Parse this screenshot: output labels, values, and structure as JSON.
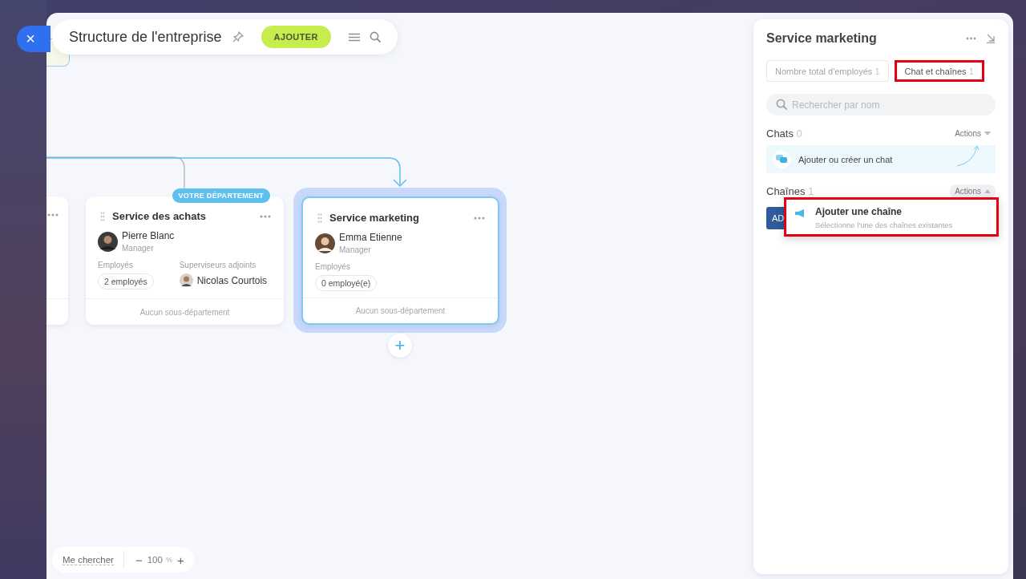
{
  "header": {
    "close": "×",
    "title": "Structure de l'entreprise",
    "add_button": "AJOUTER"
  },
  "departments": [
    {
      "name": "Service des achats",
      "badge": "VOTRE DÉPARTEMENT",
      "selected": false,
      "head": {
        "name": "Pierre Blanc",
        "role": "Manager"
      },
      "employees_label": "Employés",
      "employees": "2 employés",
      "deputies_label": "Superviseurs adjoints",
      "deputy": "Nicolas Courtois",
      "footer": "Aucun sous-département"
    },
    {
      "name": "Service marketing",
      "selected": true,
      "head": {
        "name": "Emma Etienne",
        "role": "Manager"
      },
      "employees_label": "Employés",
      "employees": "0 employé(e)",
      "footer": "Aucun sous-département"
    }
  ],
  "add_node": "+",
  "zoom": {
    "find_me": "Me chercher",
    "minus": "−",
    "value": "100",
    "unit": "%",
    "plus": "+"
  },
  "panel": {
    "title": "Service marketing",
    "tabs": [
      {
        "label": "Nombre total d'employés",
        "count": "1",
        "selected": false,
        "highlighted": false
      },
      {
        "label": "Chat et chaînes",
        "count": "1",
        "selected": true,
        "highlighted": true
      }
    ],
    "search_placeholder": "Rechercher par nom",
    "sections": [
      {
        "title": "Chats",
        "count": "0",
        "actions": "Actions",
        "expanded": false,
        "add_item": "Ajouter ou créer un chat"
      },
      {
        "title": "Chaînes",
        "count": "1",
        "actions": "Actions",
        "expanded": true,
        "button": "AD"
      }
    ],
    "menu": [
      {
        "title": "Ajouter une chaîne",
        "subtitle": "Sélectionne l'une des chaînes existantes",
        "highlighted": true
      }
    ]
  }
}
